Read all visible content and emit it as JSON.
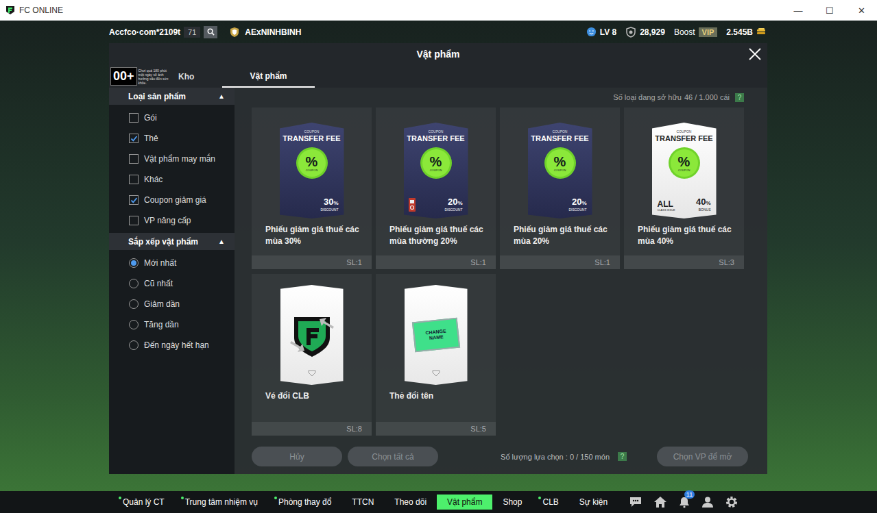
{
  "window": {
    "title": "FC ONLINE",
    "controls": [
      "—",
      "☐",
      "✕"
    ]
  },
  "hud": {
    "account": "Accfco·com*2109t",
    "count": "71",
    "team": "AExNINHBINH",
    "level": "LV 8",
    "points": "28,929",
    "boost": "Boost",
    "vip": "VIP",
    "coins": "2.545B"
  },
  "age_rating": {
    "badge": "00+",
    "notice": "Chơi quá 180 phút một ngày sẽ ảnh hưởng xấu đến sức khỏe."
  },
  "modal": {
    "title": "Vật phẩm"
  },
  "tabs": [
    {
      "label": "Kho",
      "selected": false
    },
    {
      "label": "Vật phẩm",
      "selected": true
    }
  ],
  "filters": {
    "title": "Loại sản phẩm",
    "toggle": "▲",
    "items": [
      {
        "label": "Gói",
        "checked": false
      },
      {
        "label": "Thẻ",
        "checked": true
      },
      {
        "label": "Vật phẩm may mắn",
        "checked": false
      },
      {
        "label": "Khác",
        "checked": false
      },
      {
        "label": "Coupon giảm giá",
        "checked": true
      },
      {
        "label": "VP nâng cấp",
        "checked": false
      }
    ]
  },
  "sort": {
    "title": "Sắp xếp vật phẩm",
    "toggle": "▲",
    "items": [
      {
        "label": "Mới nhất",
        "selected": true
      },
      {
        "label": "Cũ nhất",
        "selected": false
      },
      {
        "label": "Giảm dần",
        "selected": false
      },
      {
        "label": "Tăng dần",
        "selected": false
      },
      {
        "label": "Đến ngày hết hạn",
        "selected": false
      }
    ]
  },
  "owned": {
    "label": "Số loại đang sở hữu",
    "value": "46 / 1.000 cái",
    "help": "?"
  },
  "items": [
    {
      "name": "Phiếu giảm giá thuế các mùa 30%",
      "quantity": "SL:1",
      "kind": "coupon-dark",
      "locked": false,
      "art": {
        "header": "COUPON",
        "title": "TRANSFER FEE",
        "symbol": "%",
        "symbol_label": "COUPON",
        "value": "30",
        "unit": "%",
        "caption": "DISCOUNT"
      }
    },
    {
      "name": "Phiếu giảm giá thuế các mùa thường 20%",
      "quantity": "SL:1",
      "kind": "coupon-dark",
      "locked": true,
      "art": {
        "header": "COUPON",
        "title": "TRANSFER FEE",
        "symbol": "%",
        "symbol_label": "COUPON",
        "value": "20",
        "unit": "%",
        "caption": "DISCOUNT"
      }
    },
    {
      "name": "Phiếu giảm giá thuế các mùa 20%",
      "quantity": "SL:1",
      "kind": "coupon-dark",
      "locked": false,
      "art": {
        "header": "COUPON",
        "title": "TRANSFER FEE",
        "symbol": "%",
        "symbol_label": "COUPON",
        "value": "20",
        "unit": "%",
        "caption": "DISCOUNT"
      }
    },
    {
      "name": "Phiếu giảm giá thuế các mùa 40%",
      "quantity": "SL:3",
      "kind": "coupon-white",
      "locked": false,
      "art": {
        "header": "COUPON",
        "title": "TRANSFER FEE",
        "symbol": "%",
        "symbol_label": "COUPON",
        "value": "40",
        "unit": "%",
        "caption": "BONUS",
        "tag": "ALL",
        "tag_sub": "CLASS ISSUE"
      }
    },
    {
      "name": "Vé đổi CLB",
      "quantity": "SL:8",
      "kind": "club",
      "locked": false,
      "art": {}
    },
    {
      "name": "Thẻ đổi tên",
      "quantity": "SL:5",
      "kind": "rename",
      "locked": false,
      "art": {
        "label": "CHANGE NAME"
      }
    }
  ],
  "footer": {
    "cancel": {
      "label": "Hủy",
      "disabled": true
    },
    "select_all": {
      "label": "Chọn tất cả",
      "disabled": true
    },
    "selection": "Số lượng lựa chọn : 0 / 150 món",
    "help": "?",
    "open": {
      "label": "Chọn VP để mở",
      "disabled": true
    }
  },
  "nav": [
    {
      "label": "Quản lý CT",
      "dot": true,
      "selected": false
    },
    {
      "label": "Trung tâm nhiệm vụ",
      "dot": true,
      "selected": false
    },
    {
      "label": "Phòng thay đổ",
      "dot": true,
      "selected": false
    },
    {
      "label": "TTCN",
      "dot": false,
      "selected": false
    },
    {
      "label": "Theo dõi",
      "dot": false,
      "selected": false
    },
    {
      "label": "Vật phẩm",
      "dot": false,
      "selected": true
    },
    {
      "label": "Shop",
      "dot": false,
      "selected": false
    },
    {
      "label": "CLB",
      "dot": true,
      "selected": false
    },
    {
      "label": "Sự kiện",
      "dot": false,
      "selected": false
    }
  ],
  "notifications": "11"
}
